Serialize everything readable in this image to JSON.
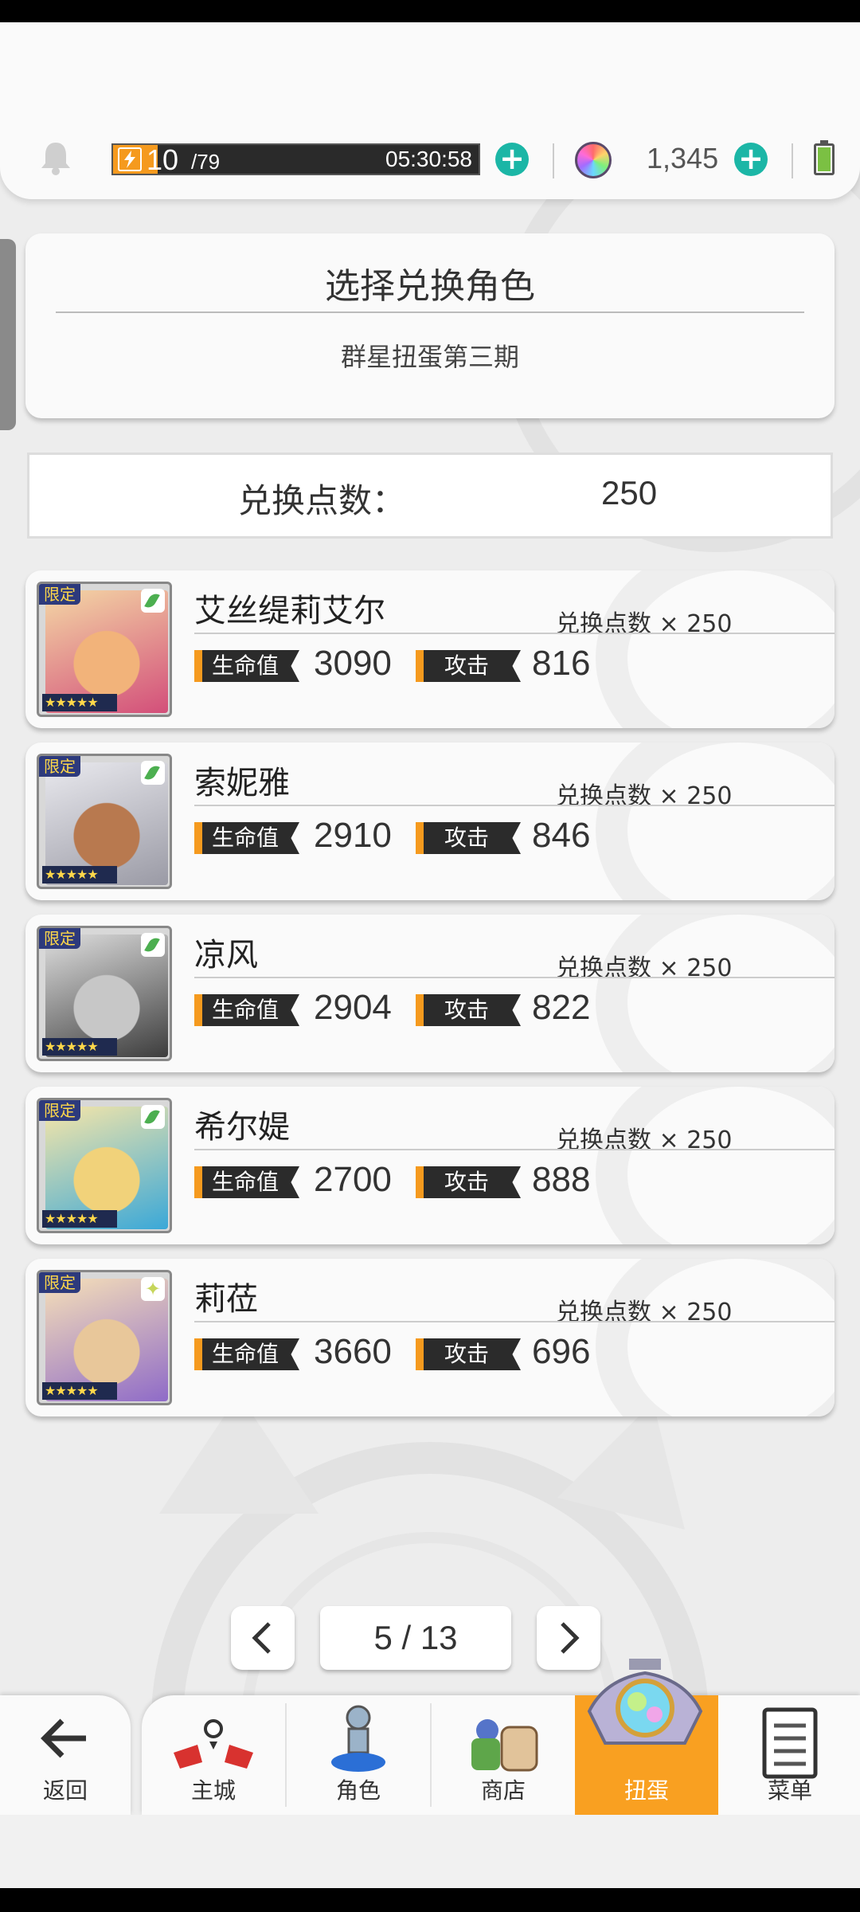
{
  "status": {
    "stamina_current": "10",
    "stamina_max": "/79",
    "stamina_timer": "05:30:58",
    "gem_count": "1,345"
  },
  "title_card": {
    "title": "选择兑换角色",
    "subtitle": "群星扭蛋第三期"
  },
  "points": {
    "label": "兑换点数：",
    "value": "250"
  },
  "stat_labels": {
    "hp": "生命值",
    "atk": "攻击"
  },
  "badge_limited": "限定",
  "characters": [
    {
      "name": "艾丝缇莉艾尔",
      "cost": "兑换点数 × 250",
      "hp": "3090",
      "atk": "816",
      "stars": "★★★★★",
      "element": "leaf-icon"
    },
    {
      "name": "索妮雅",
      "cost": "兑换点数 × 250",
      "hp": "2910",
      "atk": "846",
      "stars": "★★★★★",
      "element": "leaf-icon"
    },
    {
      "name": "凉风",
      "cost": "兑换点数 × 250",
      "hp": "2904",
      "atk": "822",
      "stars": "★★★★★",
      "element": "leaf-icon"
    },
    {
      "name": "希尔媞",
      "cost": "兑换点数 × 250",
      "hp": "2700",
      "atk": "888",
      "stars": "★★★★★",
      "element": "leaf-icon"
    },
    {
      "name": "莉莅",
      "cost": "兑换点数 × 250",
      "hp": "3660",
      "atk": "696",
      "stars": "★★★★★",
      "element": "sparkle-icon"
    }
  ],
  "pagination": {
    "page": "5 / 13"
  },
  "nav": {
    "back": "返回",
    "items": [
      "主城",
      "角色",
      "商店",
      "扭蛋",
      "菜单"
    ],
    "active_index": 3
  },
  "colors": {
    "accent_orange": "#f9a021",
    "plus_teal": "#1bb6a6",
    "stat_tag_dark": "#2b2b2b",
    "battery_green": "#7bc043"
  }
}
